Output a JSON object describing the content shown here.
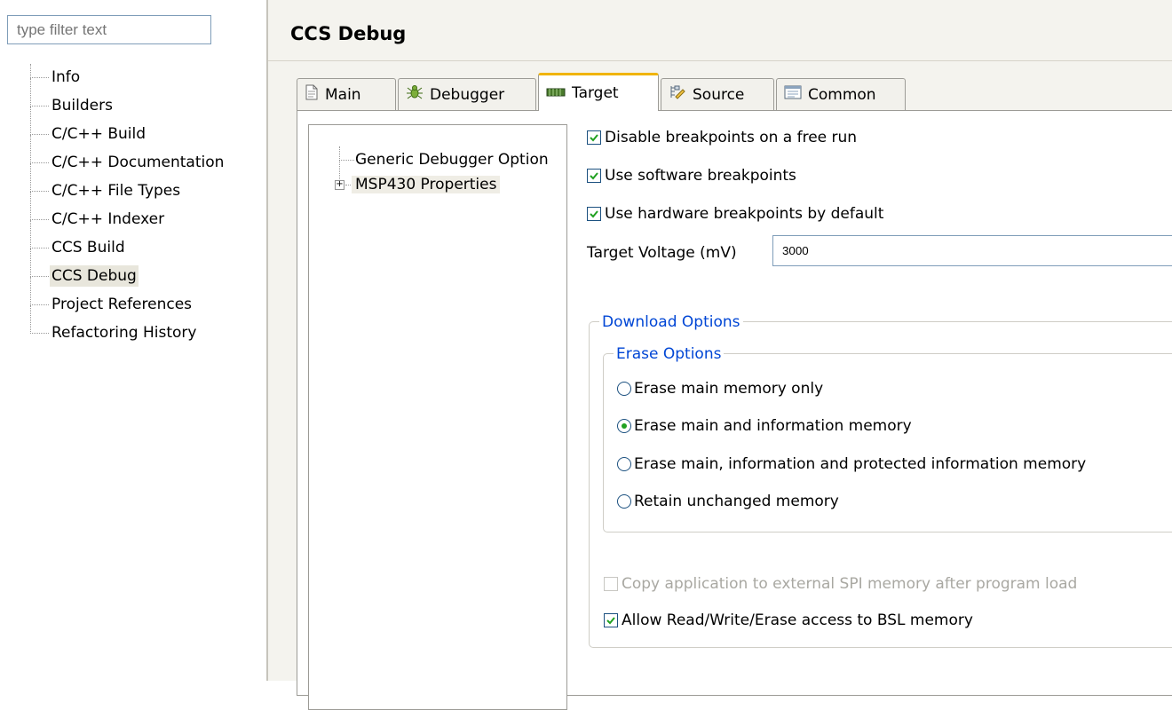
{
  "filter": {
    "placeholder": "type filter text"
  },
  "nav": {
    "items": [
      {
        "label": "Info"
      },
      {
        "label": "Builders"
      },
      {
        "label": "C/C++ Build"
      },
      {
        "label": "C/C++ Documentation"
      },
      {
        "label": "C/C++ File Types"
      },
      {
        "label": "C/C++ Indexer"
      },
      {
        "label": "CCS Build"
      },
      {
        "label": "CCS Debug",
        "selected": true
      },
      {
        "label": "Project References"
      },
      {
        "label": "Refactoring History"
      }
    ]
  },
  "page": {
    "title": "CCS Debug"
  },
  "tabs": [
    {
      "label": "Main",
      "icon": "document-icon"
    },
    {
      "label": "Debugger",
      "icon": "bug-icon"
    },
    {
      "label": "Target",
      "icon": "chip-icon",
      "active": true
    },
    {
      "label": "Source",
      "icon": "source-icon"
    },
    {
      "label": "Common",
      "icon": "window-icon"
    }
  ],
  "tree": {
    "items": [
      {
        "label": "Generic Debugger Option"
      },
      {
        "label": "MSP430 Properties",
        "expandable": true,
        "selected": true
      }
    ]
  },
  "options": {
    "disable_breakpoints": {
      "label": "Disable breakpoints on a free run",
      "checked": true
    },
    "software_breakpoints": {
      "label": "Use software breakpoints",
      "checked": true
    },
    "hardware_breakpoints": {
      "label": "Use hardware breakpoints by default",
      "checked": true
    },
    "voltage_label": "Target Voltage (mV)",
    "voltage_value": "3000",
    "download_group": "Download Options",
    "erase_group": "Erase Options",
    "erase_options": [
      {
        "label": "Erase main memory only",
        "selected": false
      },
      {
        "label": "Erase main and information memory",
        "selected": true
      },
      {
        "label": "Erase main, information and protected information memory",
        "selected": false
      },
      {
        "label": "Retain unchanged memory",
        "selected": false
      }
    ],
    "copy_spi": {
      "label": "Copy application to external SPI memory after program load",
      "checked": false,
      "disabled": true
    },
    "bsl_access": {
      "label": "Allow Read/Write/Erase access to BSL memory",
      "checked": true
    }
  },
  "colors": {
    "accent_tab": "#f0b400",
    "group_legend": "#0046d5",
    "radio_selected": "#21a121"
  }
}
